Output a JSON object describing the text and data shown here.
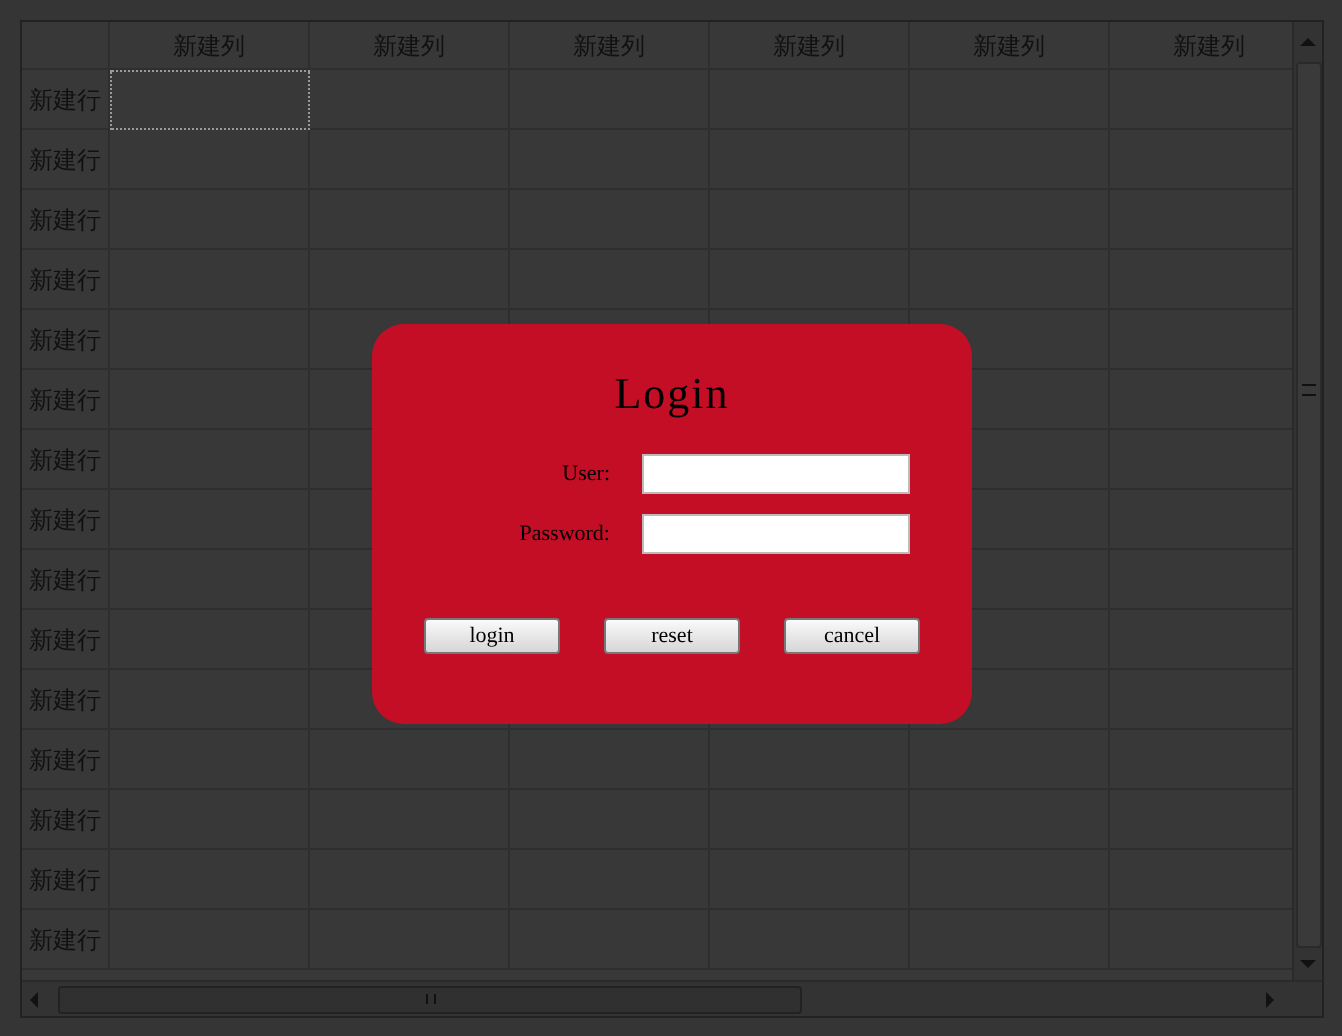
{
  "table": {
    "columns": [
      "新建列",
      "新建列",
      "新建列",
      "新建列",
      "新建列",
      "新建列"
    ],
    "rows": [
      {
        "label": "新建行",
        "focused": true
      },
      {
        "label": "新建行",
        "focused": false
      },
      {
        "label": "新建行",
        "focused": false
      },
      {
        "label": "新建行",
        "focused": false
      },
      {
        "label": "新建行",
        "focused": false
      },
      {
        "label": "新建行",
        "focused": false
      },
      {
        "label": "新建行",
        "focused": false
      },
      {
        "label": "新建行",
        "focused": false
      },
      {
        "label": "新建行",
        "focused": false
      },
      {
        "label": "新建行",
        "focused": false
      },
      {
        "label": "新建行",
        "focused": false
      },
      {
        "label": "新建行",
        "focused": false
      },
      {
        "label": "新建行",
        "focused": false
      },
      {
        "label": "新建行",
        "focused": false
      },
      {
        "label": "新建行",
        "focused": false
      }
    ]
  },
  "dialog": {
    "title": "Login",
    "fields": [
      {
        "label": "User:"
      },
      {
        "label": "Password:"
      }
    ],
    "buttons": [
      "login",
      "reset",
      "cancel"
    ]
  }
}
